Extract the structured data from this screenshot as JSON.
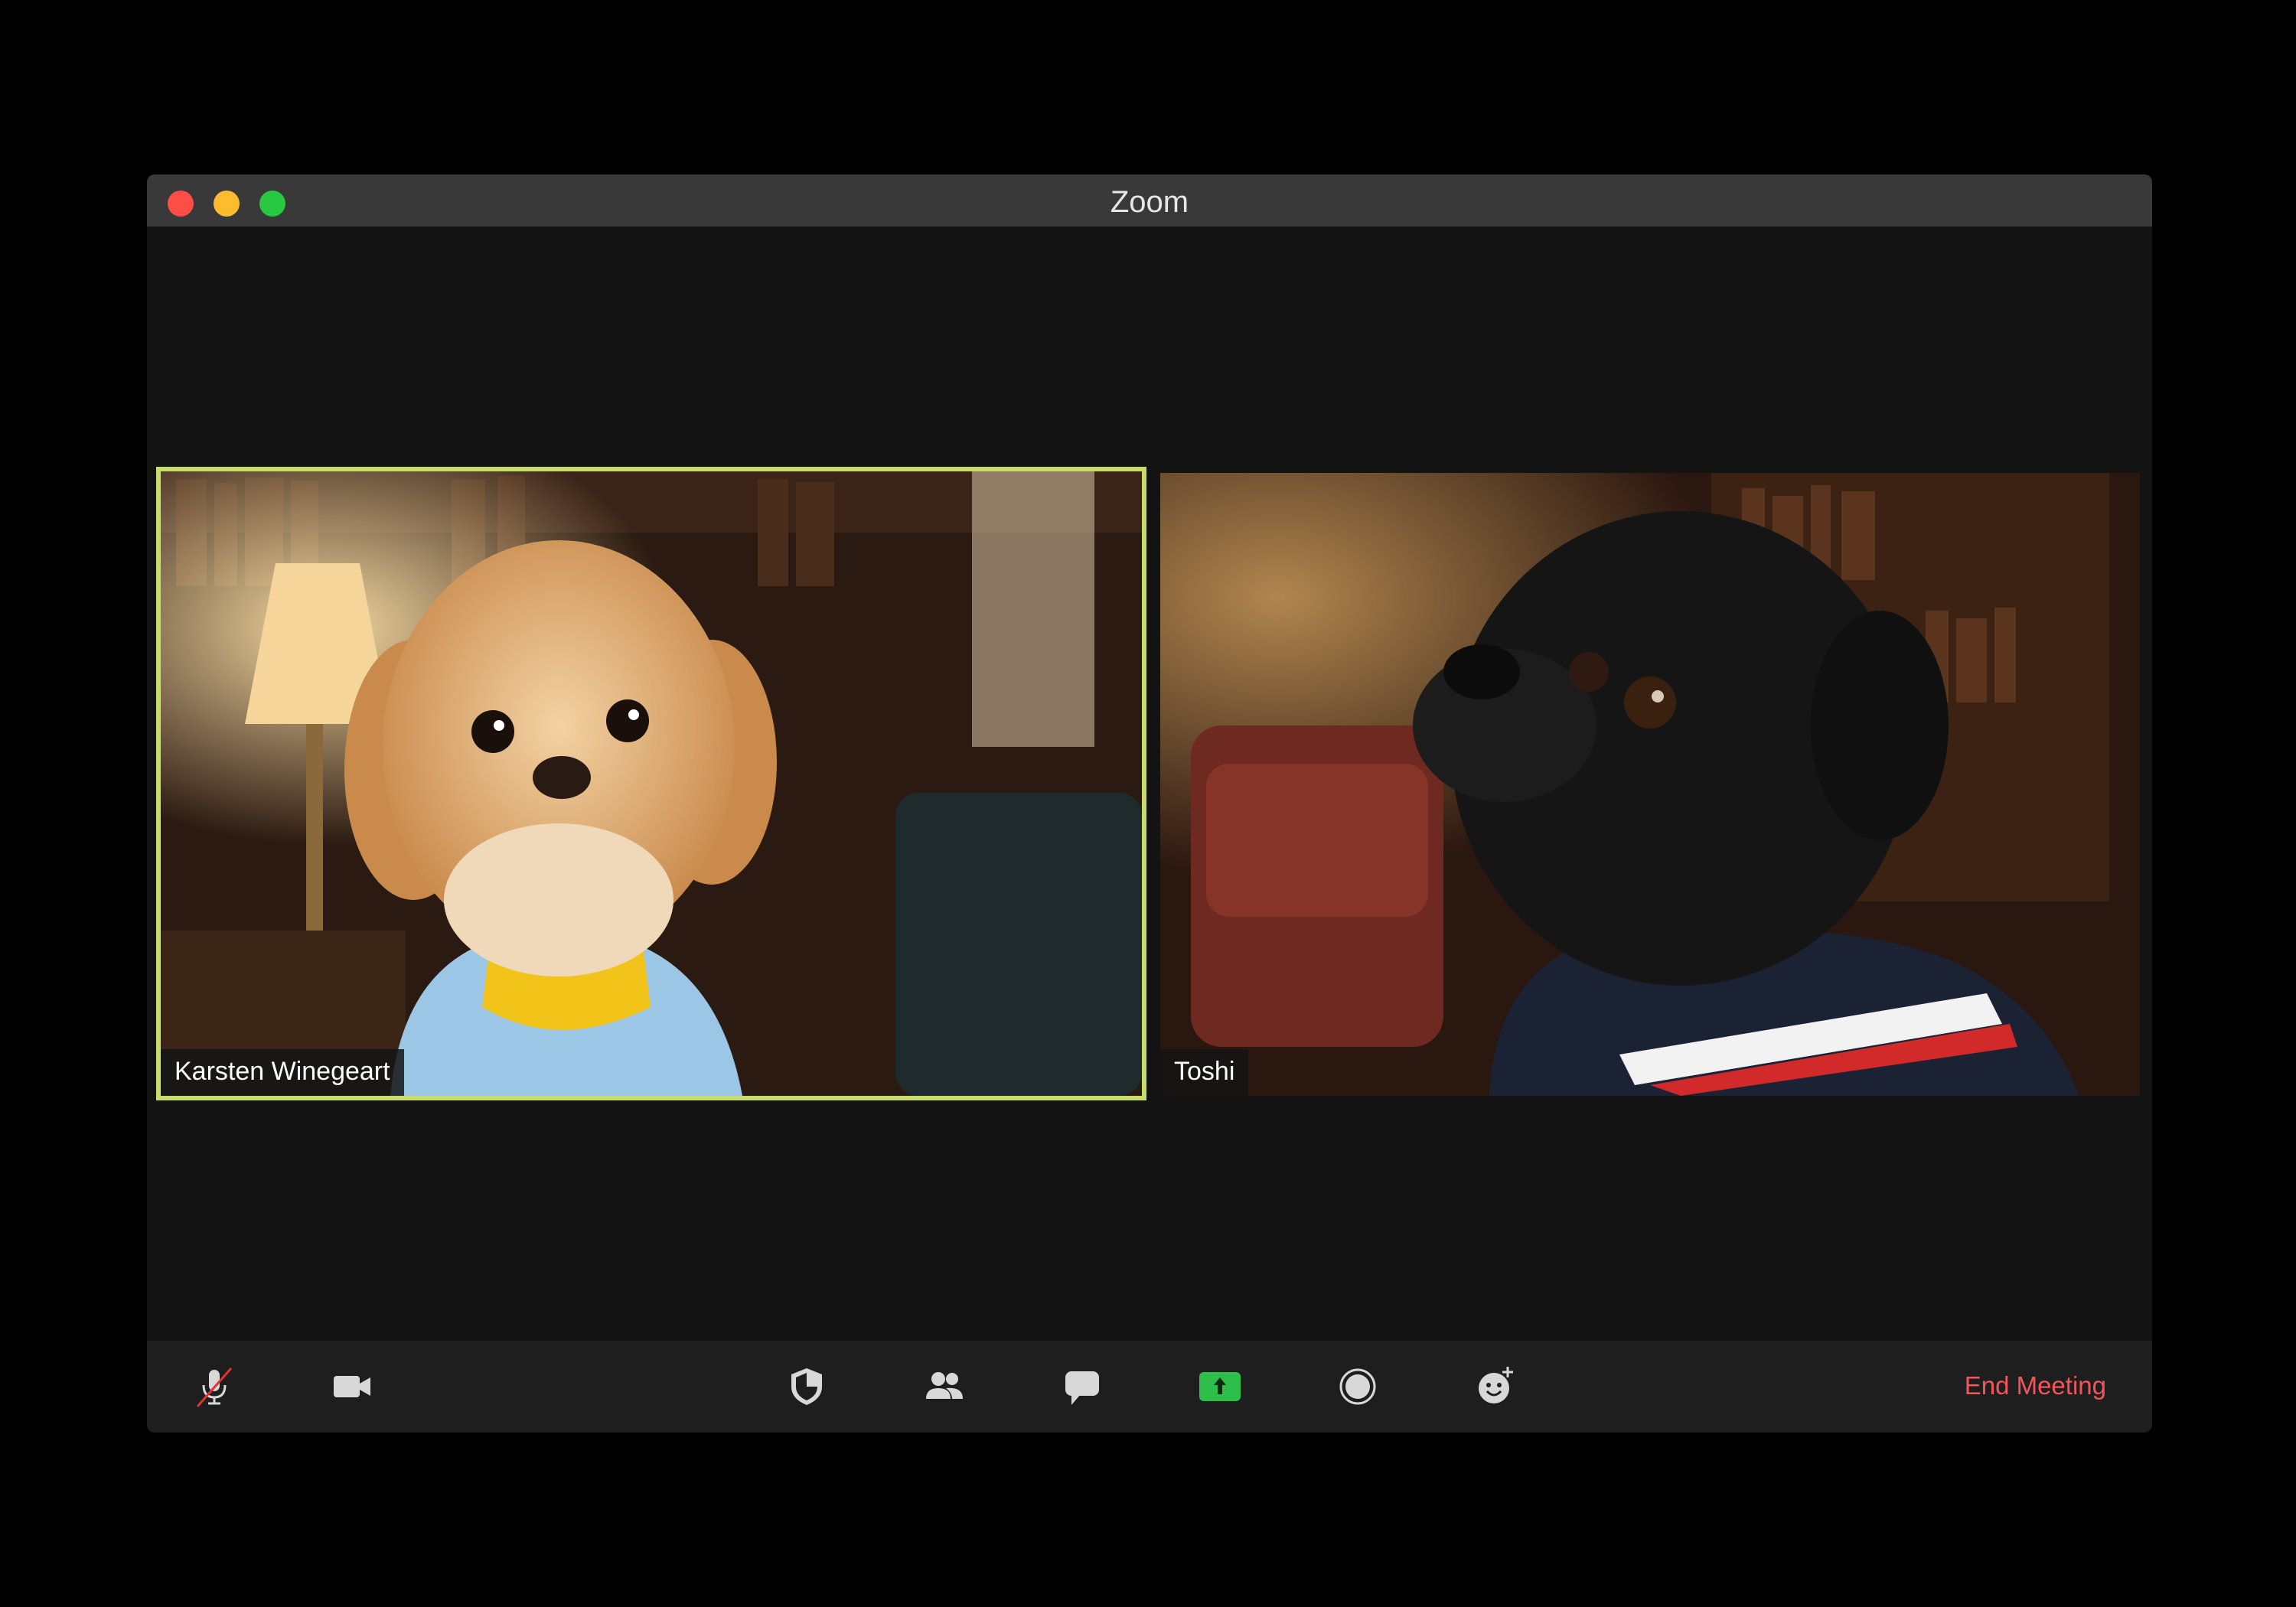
{
  "window": {
    "title": "Zoom"
  },
  "participants": [
    {
      "name": "Karsten Winegeart",
      "active_speaker": true
    },
    {
      "name": "Toshi",
      "active_speaker": false
    }
  ],
  "toolbar": {
    "buttons": [
      {
        "icon": "microphone-muted-icon"
      },
      {
        "icon": "video-camera-icon"
      },
      {
        "icon": "security-shield-icon"
      },
      {
        "icon": "participants-icon"
      },
      {
        "icon": "chat-icon"
      },
      {
        "icon": "share-screen-icon"
      },
      {
        "icon": "record-icon"
      },
      {
        "icon": "reactions-icon"
      }
    ],
    "end_label": "End Meeting"
  },
  "colors": {
    "active_speaker_border": "#c6dd6c",
    "share_button": "#2dbf4a",
    "end_meeting": "#f2555a",
    "muted_slash": "#e0342f"
  }
}
